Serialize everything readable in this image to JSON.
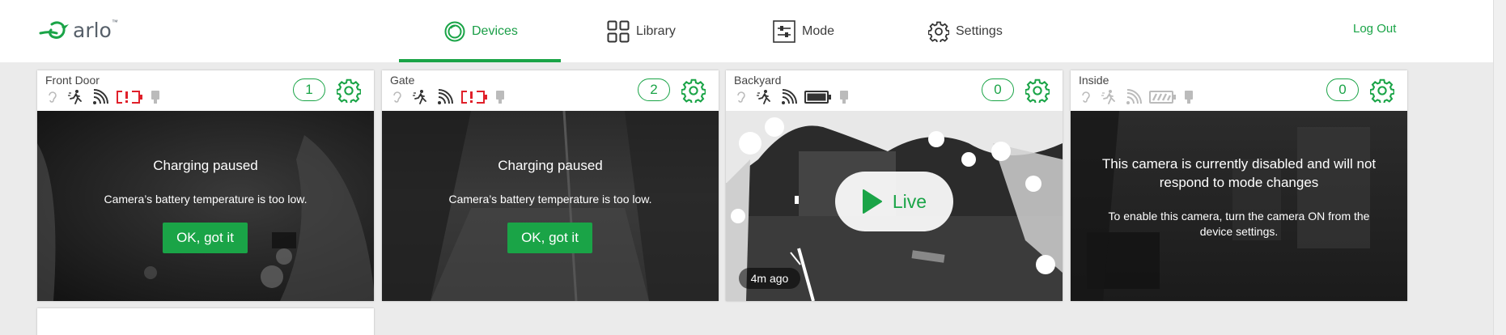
{
  "brand": {
    "logo_text": "arlo",
    "logo_tm": "™",
    "accent": "#1aa447"
  },
  "nav": {
    "items": [
      {
        "label": "Devices",
        "icon": "devices-icon",
        "active": true
      },
      {
        "label": "Library",
        "icon": "library-grid-icon",
        "active": false
      },
      {
        "label": "Mode",
        "icon": "mode-sliders-icon",
        "active": false
      },
      {
        "label": "Settings",
        "icon": "settings-gear-icon",
        "active": false
      }
    ],
    "logout": "Log Out"
  },
  "cameras": [
    {
      "name": "Front Door",
      "count": "1",
      "status_icons": [
        "audio-icon",
        "motion-icon",
        "signal-icon",
        "battery-alert-icon",
        "power-icon"
      ],
      "overlay": {
        "title": "Charging paused",
        "text": "Camera’s battery temperature is too low.",
        "button": "OK, got it"
      }
    },
    {
      "name": "Gate",
      "count": "2",
      "status_icons": [
        "audio-icon",
        "motion-icon",
        "signal-icon",
        "battery-alert-icon",
        "power-icon"
      ],
      "overlay": {
        "title": "Charging paused",
        "text": "Camera’s battery temperature is too low.",
        "button": "OK, got it"
      }
    },
    {
      "name": "Backyard",
      "count": "0",
      "status_icons": [
        "audio-icon",
        "motion-icon",
        "signal-icon",
        "battery-full-icon",
        "power-icon"
      ],
      "live": {
        "label": "Live",
        "time": "4m ago"
      }
    },
    {
      "name": "Inside",
      "count": "0",
      "status_icons": [
        "audio-icon",
        "motion-icon",
        "signal-icon",
        "battery-icon",
        "power-icon"
      ],
      "disabled": {
        "title": "This camera is currently disabled and will not respond to mode changes",
        "text": "To enable this camera, turn the camera ON from the device settings."
      }
    }
  ]
}
